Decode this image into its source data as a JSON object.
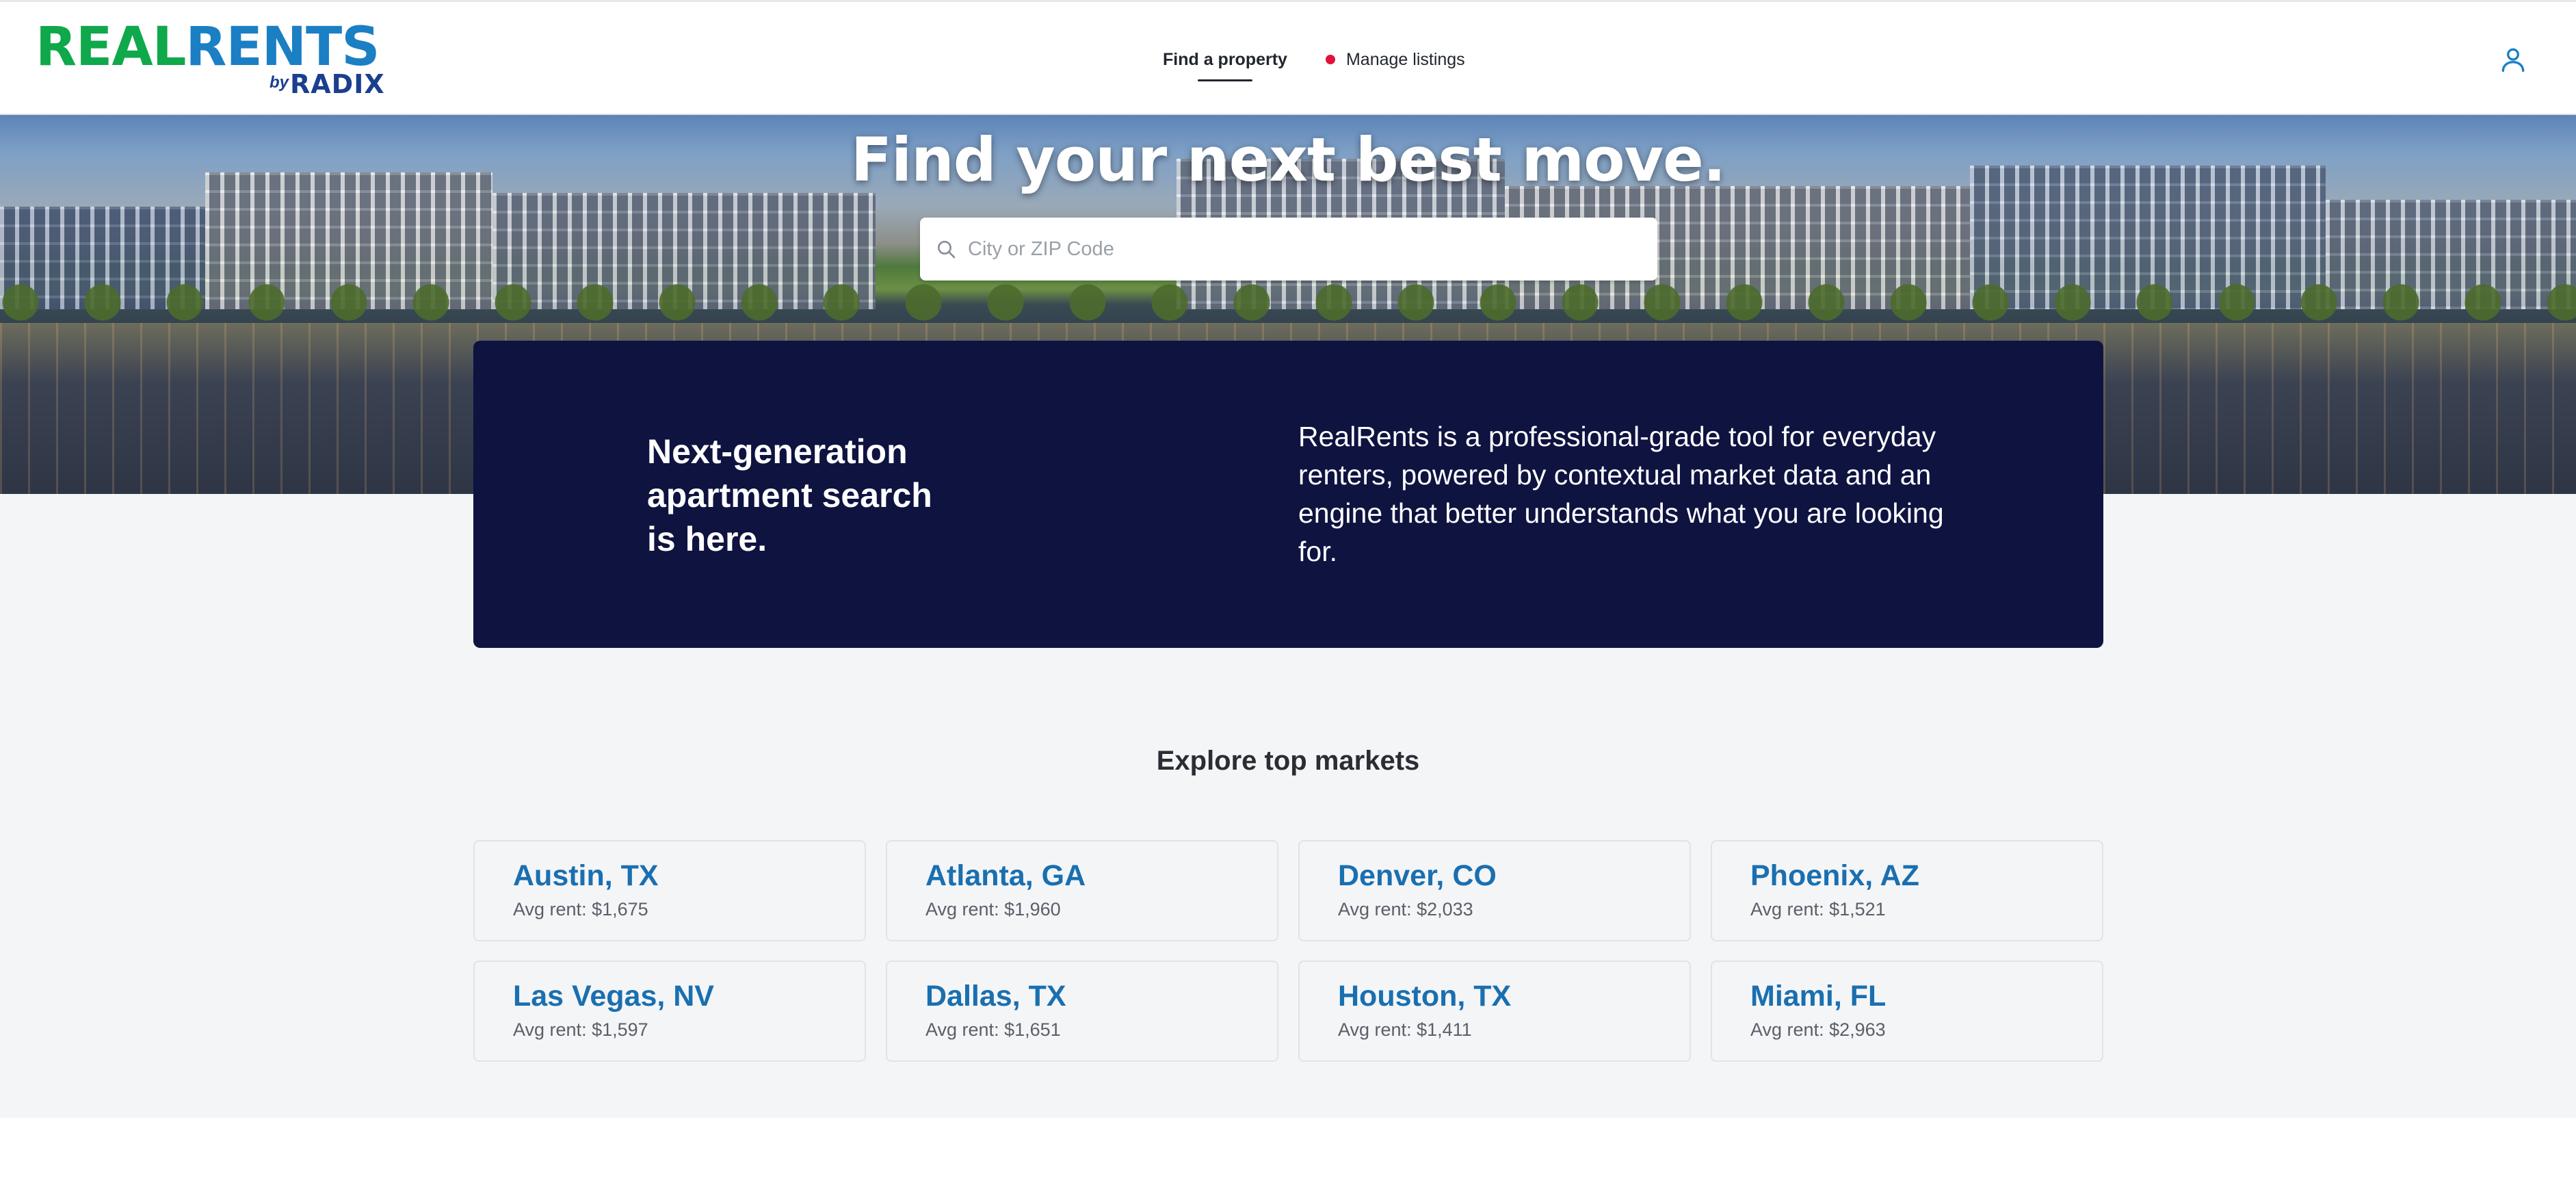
{
  "brand": {
    "real": "REAL",
    "rents": "RENTS",
    "by": "by",
    "radix": "RADIX"
  },
  "nav": {
    "find": "Find a property",
    "manage": "Manage listings"
  },
  "hero": {
    "title": "Find your next best move.",
    "search_placeholder": "City or ZIP Code"
  },
  "info": {
    "heading": "Next-generation apartment search is here.",
    "body": "RealRents is a professional-grade tool for everyday renters, powered by contextual market data and an engine that better understands what you are looking for."
  },
  "markets": {
    "title": "Explore top markets",
    "items": [
      {
        "name": "Austin, TX",
        "rent": "Avg rent: $1,675"
      },
      {
        "name": "Atlanta, GA",
        "rent": "Avg rent: $1,960"
      },
      {
        "name": "Denver, CO",
        "rent": "Avg rent: $2,033"
      },
      {
        "name": "Phoenix, AZ",
        "rent": "Avg rent: $1,521"
      },
      {
        "name": "Las Vegas, NV",
        "rent": "Avg rent: $1,597"
      },
      {
        "name": "Dallas, TX",
        "rent": "Avg rent: $1,651"
      },
      {
        "name": "Houston, TX",
        "rent": "Avg rent: $1,411"
      },
      {
        "name": "Miami, FL",
        "rent": "Avg rent: $2,963"
      }
    ]
  },
  "colors": {
    "brand_green": "#0fa84a",
    "brand_blue": "#1b7fc4",
    "info_card_bg": "#0e1340",
    "market_link": "#1a6fb0",
    "notification_dot": "#e0123c"
  },
  "icons": {
    "search": "search-icon",
    "user": "user-icon"
  }
}
